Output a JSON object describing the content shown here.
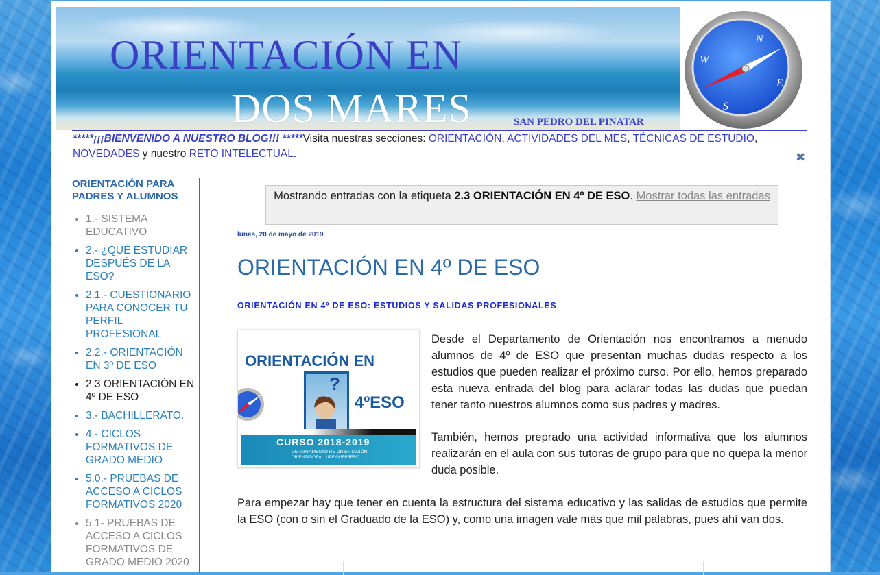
{
  "header": {
    "title_line1": "ORIENTACIÓN EN",
    "title_line2": "DOS MARES",
    "subtitle": "SAN PEDRO DEL PINATAR"
  },
  "welcome": {
    "emph": "*****¡¡¡BIENVENIDO A NUESTRO BLOG!!! *****",
    "text1": "Visita nuestras secciones: ",
    "links": [
      "ORIENTACIÓN",
      "ACTIVIDADES DEL MES",
      "TÉCNICAS DE ESTUDIO",
      "NOVEDADES"
    ],
    "sep": ", ",
    "text2": " y nuestro ",
    "reto": "RETO INTELECTUAL",
    "end": "."
  },
  "sidebar": {
    "heading": "ORIENTACIÓN PARA PADRES Y ALUMNOS",
    "items": [
      {
        "label": "1.- SISTEMA EDUCATIVO",
        "color": "#888888"
      },
      {
        "label": "2.- ¿QUÉ ESTUDIAR DESPUÉS DE LA ESO?",
        "color": "#2a80b8"
      },
      {
        "label": "2.1.- CUESTIONARIO PARA CONOCER TU PERFIL PROFESIONAL",
        "color": "#2a80b8"
      },
      {
        "label": "2.2.- ORIENTACIÓN EN 3º DE ESO",
        "color": "#2a80b8"
      },
      {
        "label": "2.3 ORIENTACIÓN EN 4º DE ESO",
        "color": "#222222"
      },
      {
        "label": "3.- BACHILLERATO.",
        "color": "#2a80b8"
      },
      {
        "label": "4.- CICLOS FORMATIVOS DE GRADO MEDIO",
        "color": "#2a80b8"
      },
      {
        "label": "5.0.- PRUEBAS DE ACCESO A CICLOS FORMATIVOS 2020",
        "color": "#2a80b8"
      },
      {
        "label": "5.1- PRUEBAS DE ACCESO A CICLOS FORMATIVOS DE GRADO MEDIO 2020",
        "color": "#888888"
      }
    ]
  },
  "label_bar": {
    "prefix": "Mostrando entradas con la etiqueta ",
    "tag": "2.3 ORIENTACIÓN EN 4º DE ESO",
    "dot": ". ",
    "show_all": "Mostrar todas las entradas"
  },
  "post": {
    "date": "lunes, 20 de mayo de 2019",
    "title": "ORIENTACIÓN EN 4º DE ESO",
    "subtitle": "ORIENTACIÓN EN 4º DE ESO:  ESTUDIOS Y SALIDAS PROFESIONALES",
    "image": {
      "title": "ORIENTACIÓN EN",
      "eso": "4ºESO",
      "course": "CURSO 2018-2019",
      "dept": "DEPARTAMENTO DE ORIENTACIÓN",
      "author": "ORIENTADORA: LUPE GUERRERO"
    },
    "p1": "Desde el Departamento de Orientación nos encontramos a menudo alumnos de 4º de ESO que presentan muchas dudas respecto a los estudios que pueden realizar el próximo curso.  Por ello, hemos preparado esta nueva entrada del blog para aclarar todas las dudas que puedan tener tanto nuestros alumnos como sus padres y madres.",
    "p2": "También, hemos preprado una actividad informativa que los alumnos  realizarán en el aula con sus tutoras de grupo para que no quepa la menor duda posible.",
    "p3": "Para empezar hay que tener en cuenta la estructura del sistema educativo y las salidas de estudios que permite la ESO (con o sin el Graduado de la ESO) y, como una imagen vale más que mil palabras, pues ahí van dos."
  }
}
